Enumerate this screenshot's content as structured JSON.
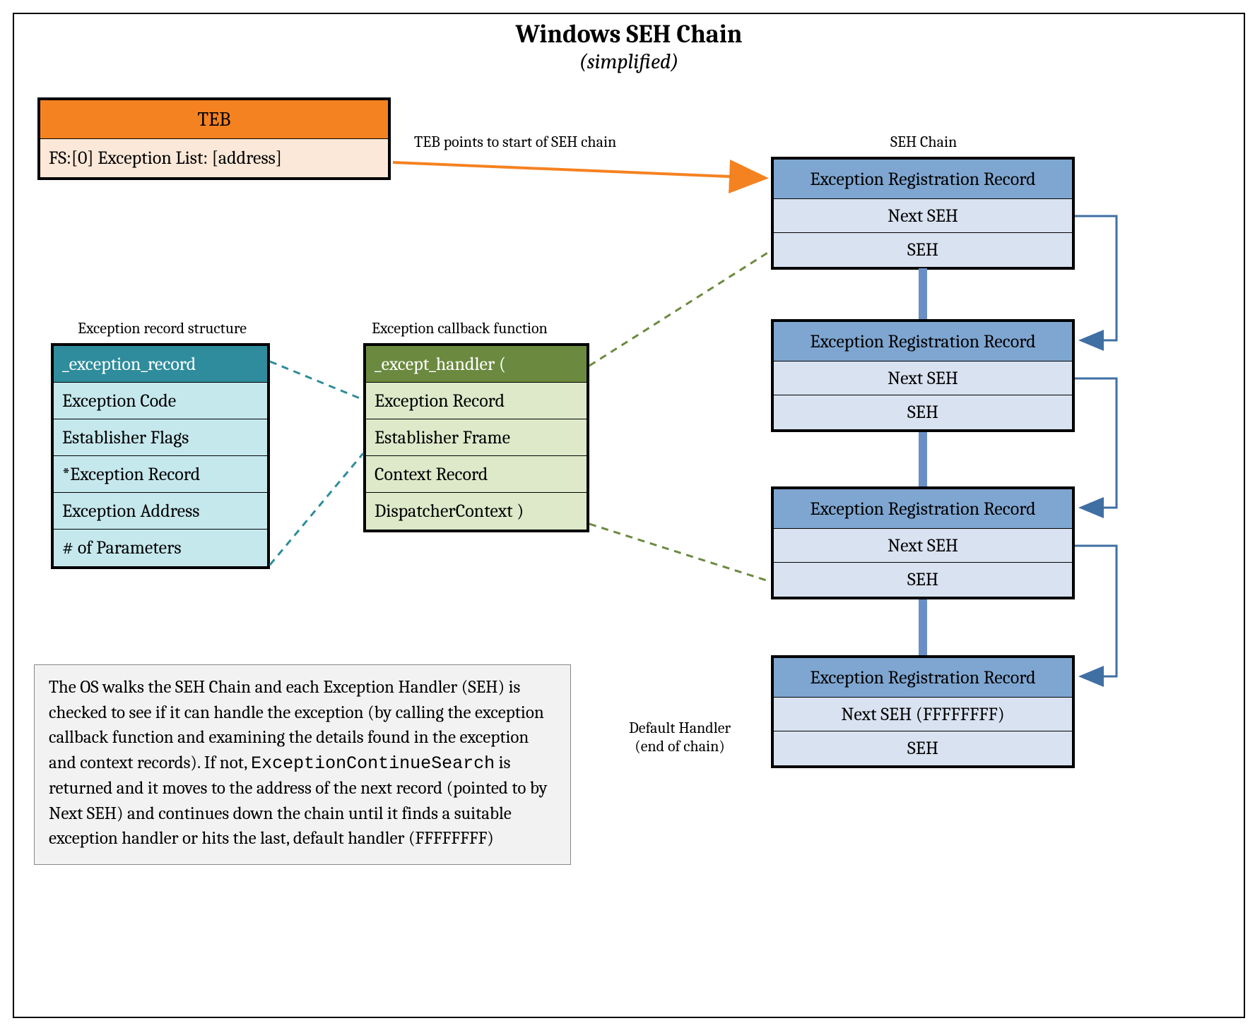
{
  "title": "Windows SEH Chain",
  "subtitle": "(simplified)",
  "teb": {
    "header": "TEB",
    "body": "FS:[0] Exception List: [address]"
  },
  "arrow_label": "TEB points to start of SEH chain",
  "labels": {
    "seh_chain": "SEH Chain",
    "exception_record_structure": "Exception record structure",
    "exception_callback_function": "Exception callback function",
    "default_handler_line1": "Default Handler",
    "default_handler_line2": "(end of chain)"
  },
  "seh_records": [
    {
      "header": "Exception Registration Record",
      "next": "Next SEH",
      "seh": "SEH"
    },
    {
      "header": "Exception Registration Record",
      "next": "Next SEH",
      "seh": "SEH"
    },
    {
      "header": "Exception Registration Record",
      "next": "Next SEH",
      "seh": "SEH"
    },
    {
      "header": "Exception Registration Record",
      "next": "Next SEH (FFFFFFFF)",
      "seh": "SEH"
    }
  ],
  "exception_record": {
    "header": "_exception_record",
    "rows": [
      "Exception Code",
      "Establisher Flags",
      "*Exception Record",
      "Exception Address",
      "# of Parameters"
    ]
  },
  "callback": {
    "header": "_except_handler (",
    "rows": [
      "Exception Record",
      "Establisher Frame",
      "Context Record",
      "DispatcherContext )"
    ]
  },
  "info": {
    "pre": "The OS walks the SEH Chain and each Exception Handler (SEH) is checked to see if it can handle the exception (by calling the exception callback function and examining the details found in the exception and context records). If not, ",
    "code": "ExceptionContinueSearch",
    "post": " is returned and it moves to the address of the next record (pointed to by Next SEH) and continues down the chain until it finds a suitable exception handler or hits the last, default handler (FFFFFFFF)"
  }
}
